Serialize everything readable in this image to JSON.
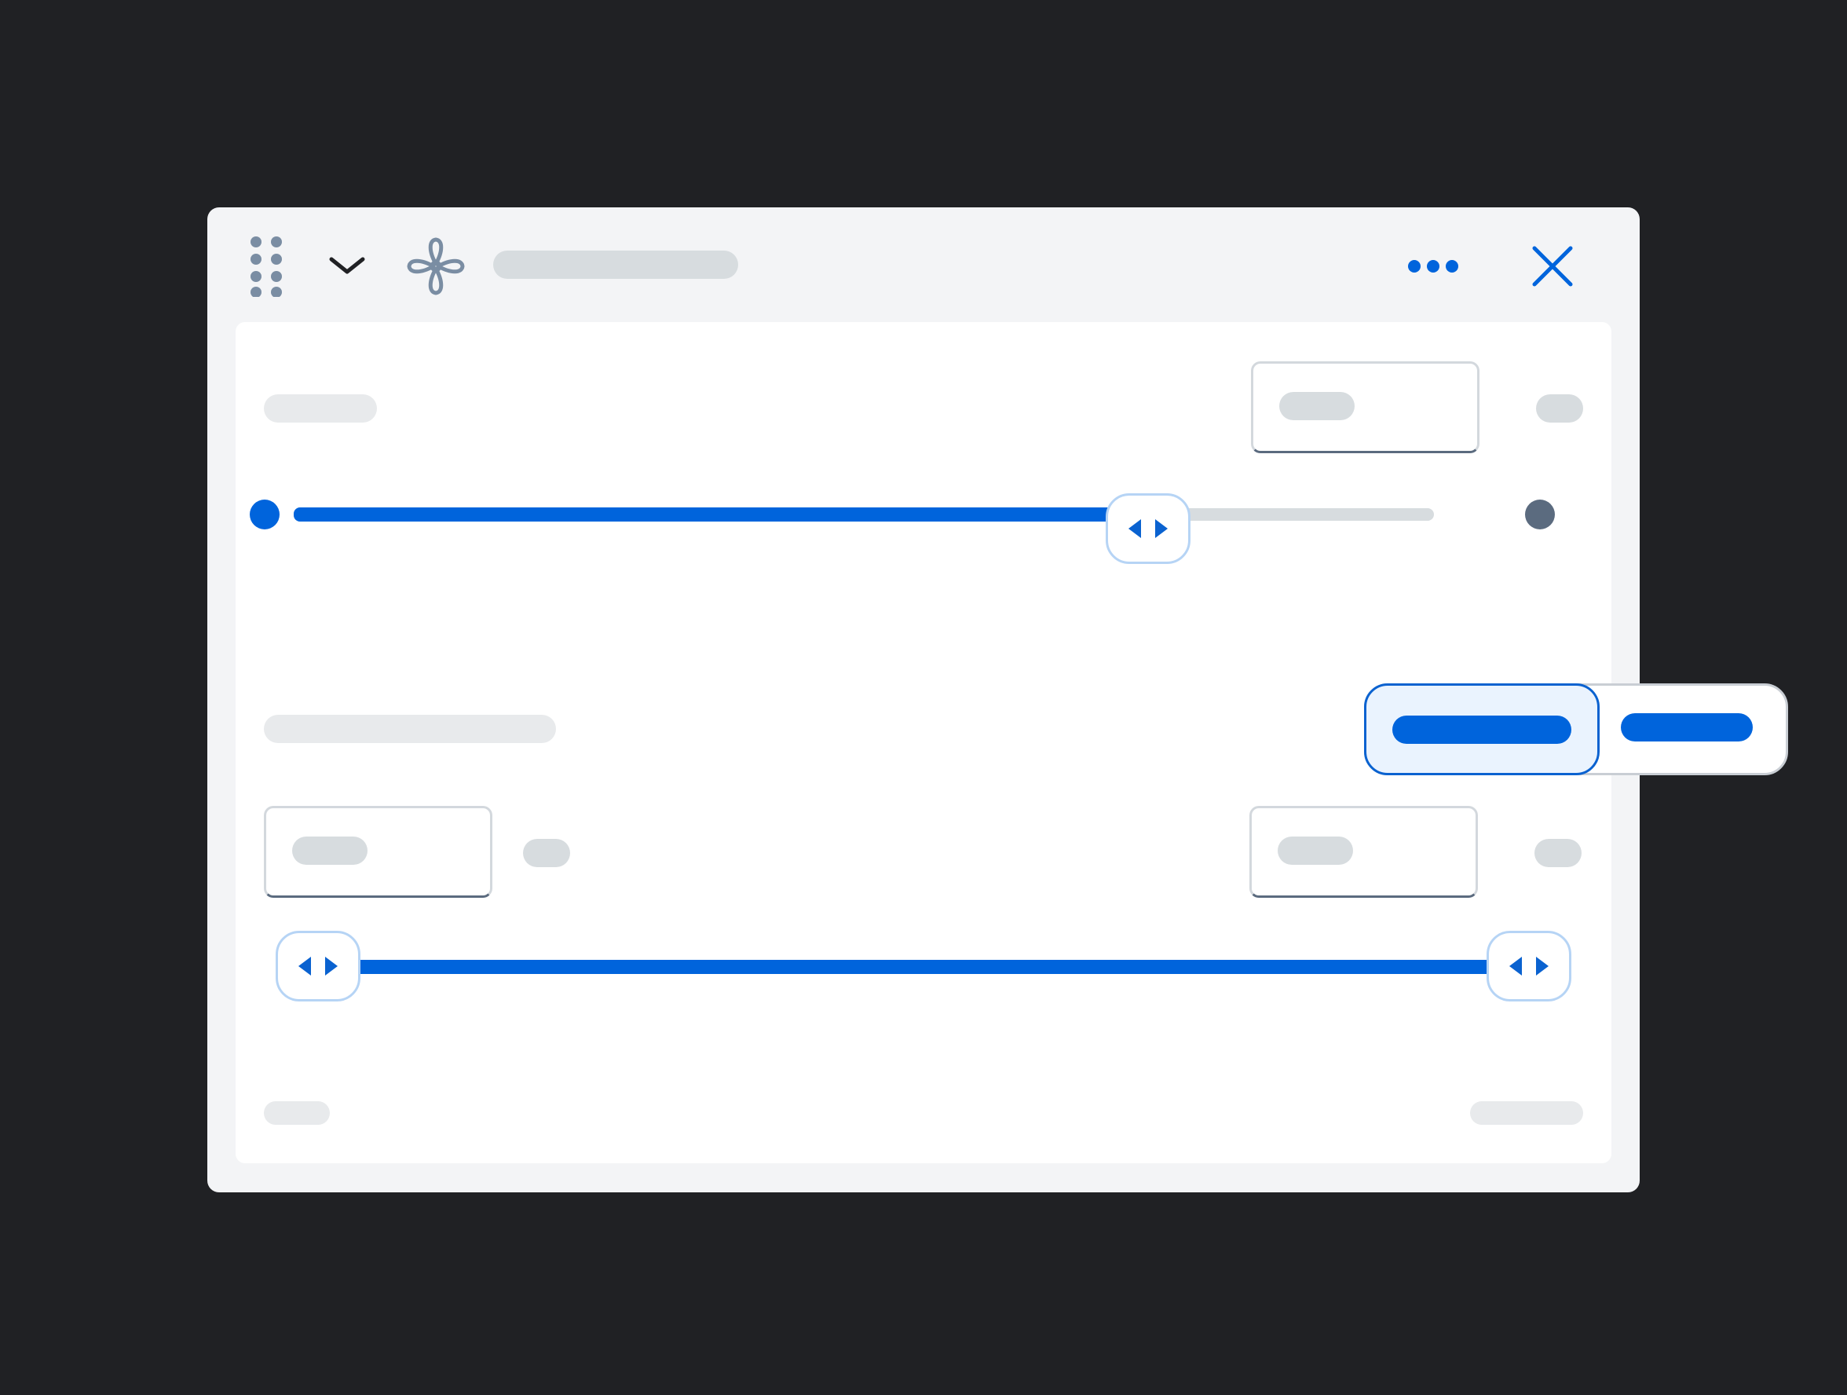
{
  "window": {
    "title": "",
    "icons": {
      "drag_handle": "drag-handle-icon",
      "collapse": "chevron-down-icon",
      "app": "fan-icon",
      "more": "more-horizontal-icon",
      "close": "close-icon"
    }
  },
  "single_slider": {
    "label": "",
    "value_field": "",
    "unit": "",
    "level": 0.73
  },
  "range_section": {
    "label": "",
    "toggle": {
      "options": [
        "",
        ""
      ],
      "selected_index": 0
    },
    "min_field": "",
    "min_unit": "",
    "max_field": "",
    "max_unit": "",
    "range_low": 0.0,
    "range_high": 1.0
  },
  "footer": {
    "left_text": "",
    "right_text": ""
  },
  "colors": {
    "background": "#202124",
    "window": "#f3f4f6",
    "panel": "#ffffff",
    "accent": "#0064dc",
    "accent_light": "#eaf3fe",
    "thumb_border": "#b6d4f5",
    "placeholder": "#d7dcdf",
    "icon_gray": "#7a8da3",
    "end_dot_gray": "#5b6b7f"
  }
}
